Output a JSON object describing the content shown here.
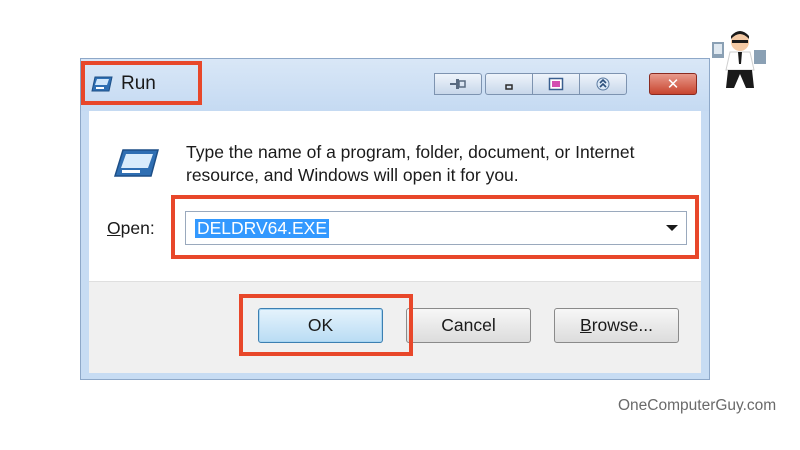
{
  "window": {
    "title": "Run",
    "controls": [
      "pin-icon",
      "minimize-icon",
      "window-icon",
      "restore-icon"
    ],
    "close_label": "✕"
  },
  "dialog": {
    "description": "Type the name of a program, folder, document, or Internet resource, and Windows will open it for you.",
    "open_label": "Open:",
    "open_value": "DELDRV64.EXE"
  },
  "buttons": {
    "ok": "OK",
    "cancel": "Cancel",
    "browse": "Browse..."
  },
  "watermark": "OneComputerGuy.com",
  "colors": {
    "highlight": "#e8472a",
    "selection": "#3399ff",
    "close_button": "#c8452f",
    "window_frame": "#c7dcf3"
  }
}
